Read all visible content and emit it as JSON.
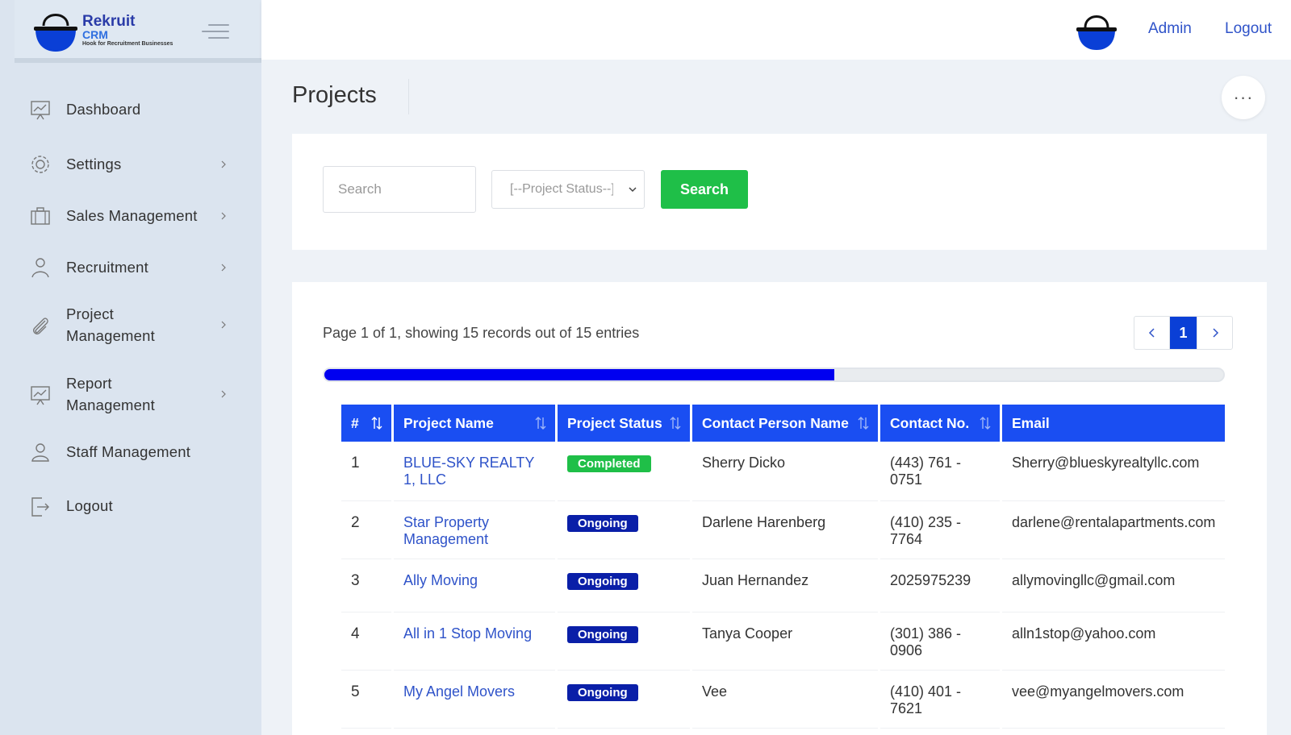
{
  "brand": {
    "name_line1": "Rekruit",
    "name_line2": "CRM",
    "tagline": "Hook for Recruitment Businesses",
    "accent": "#0a3fd6"
  },
  "sidebar": {
    "items": [
      {
        "label": "Dashboard",
        "icon": "chart-board-icon",
        "has_chevron": false
      },
      {
        "label": "Settings",
        "icon": "gear-icon",
        "has_chevron": true
      },
      {
        "label": "Sales Management",
        "icon": "briefcase-icon",
        "has_chevron": true
      },
      {
        "label": "Recruitment",
        "icon": "user-icon",
        "has_chevron": true
      },
      {
        "label_line1": "Project",
        "label_line2": "Management",
        "icon": "paperclip-icon",
        "has_chevron": true
      },
      {
        "label_line1": "Report",
        "label_line2": "Management",
        "icon": "chart-board-icon",
        "has_chevron": true
      },
      {
        "label": "Staff Management",
        "icon": "users-icon",
        "has_chevron": false
      },
      {
        "label": "Logout",
        "icon": "logout-icon",
        "has_chevron": false
      }
    ]
  },
  "header": {
    "admin_label": "Admin",
    "logout_label": "Logout"
  },
  "page": {
    "title": "Projects"
  },
  "filters": {
    "search_placeholder": "Search",
    "status_placeholder": "[--Project Status--]",
    "search_button": "Search"
  },
  "listing": {
    "records_info": "Page 1 of 1, showing 15 records out of 15 entries",
    "current_page": "1",
    "progress_percent": 56.7
  },
  "table": {
    "columns": [
      "#",
      "Project Name",
      "Project Status",
      "Contact Person Name",
      "Contact No.",
      "Email"
    ],
    "rows": [
      {
        "num": "1",
        "name": "BLUE-SKY REALTY 1, LLC",
        "status": "Completed",
        "status_type": "completed",
        "contact": "Sherry Dicko",
        "phone": "(443) 761 - 0751",
        "email": "Sherry@blueskyrealtyllc.com"
      },
      {
        "num": "2",
        "name": "Star Property Management",
        "status": "Ongoing",
        "status_type": "ongoing",
        "contact": "Darlene Harenberg",
        "phone": "(410) 235 - 7764",
        "email": "darlene@rentalapartments.com"
      },
      {
        "num": "3",
        "name": "Ally Moving",
        "status": "Ongoing",
        "status_type": "ongoing",
        "contact": "Juan Hernandez",
        "phone": "2025975239",
        "email": "allymovingllc@gmail.com"
      },
      {
        "num": "4",
        "name": "All in 1 Stop Moving",
        "status": "Ongoing",
        "status_type": "ongoing",
        "contact": "Tanya Cooper",
        "phone": "(301) 386 - 0906",
        "email": "alln1stop@yahoo.com"
      },
      {
        "num": "5",
        "name": "My Angel Movers",
        "status": "Ongoing",
        "status_type": "ongoing",
        "contact": "Vee",
        "phone": "(410) 401 - 7621",
        "email": "vee@myangelmovers.com"
      }
    ]
  }
}
